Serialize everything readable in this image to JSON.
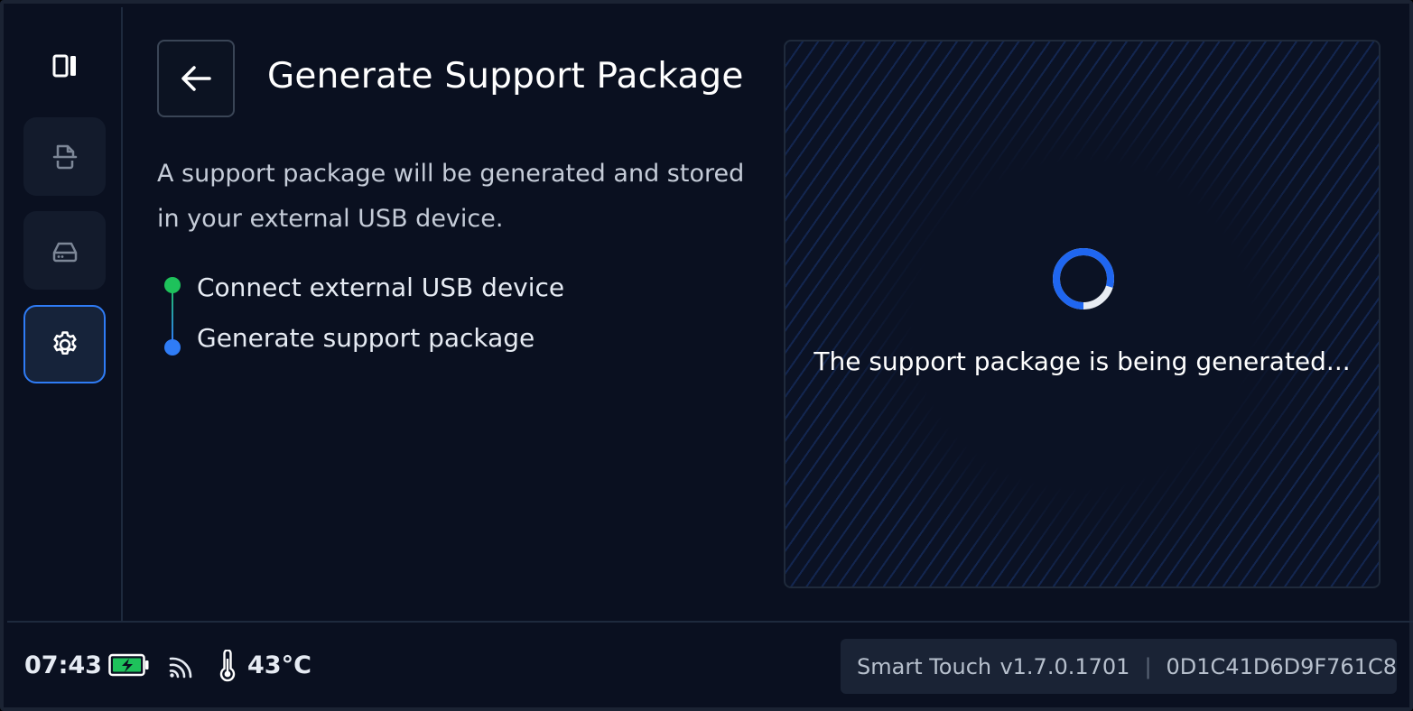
{
  "page": {
    "title": "Generate Support Package",
    "description": "A support package will be generated and stored in your external USB device."
  },
  "sidebar": {
    "toggle_icon": "sidebar-toggle-icon",
    "items": [
      {
        "name": "documents",
        "icon": "document-icon",
        "active": false
      },
      {
        "name": "storage",
        "icon": "drive-icon",
        "active": false
      },
      {
        "name": "settings",
        "icon": "gear-icon",
        "active": true
      }
    ]
  },
  "steps": [
    {
      "label": "Connect external USB device",
      "status": "done"
    },
    {
      "label": "Generate support package",
      "status": "current"
    }
  ],
  "progress_panel": {
    "status_text": "The support package is being generated..."
  },
  "footer": {
    "time": "07:43",
    "battery_icon": "battery-charging-icon",
    "signal_icon": "wifi-signal-icon",
    "temperature": "43°C",
    "app_name": "Smart Touch",
    "version": "v1.7.0.1701",
    "device_id": "0D1C41D6D9F761C8"
  },
  "colors": {
    "background": "#0a1020",
    "accent": "#2f7cf6",
    "success": "#1ec25b"
  }
}
